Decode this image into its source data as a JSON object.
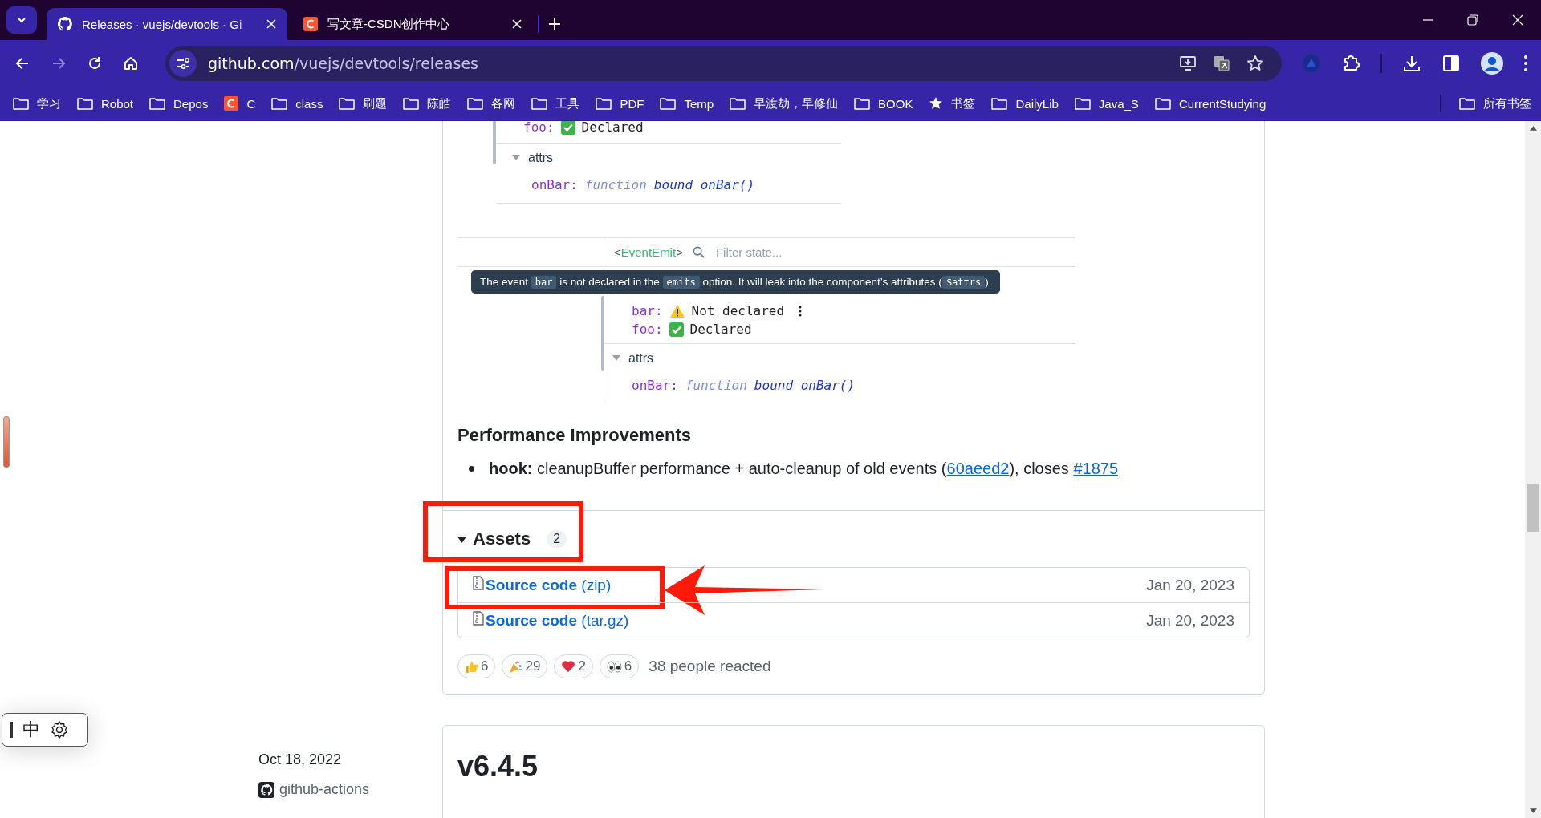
{
  "browser": {
    "tabs": [
      {
        "title": "Releases · vuejs/devtools · Gi",
        "kind": "github",
        "selected": true
      },
      {
        "title": "写文章-CSDN创作中心",
        "kind": "csdn",
        "selected": false
      }
    ],
    "url": {
      "host": "github.com",
      "path": "/vuejs/devtools/releases"
    },
    "bookmarks": [
      {
        "label": "学习",
        "kind": "folder"
      },
      {
        "label": "Robot",
        "kind": "folder"
      },
      {
        "label": "Depos",
        "kind": "folder"
      },
      {
        "label": "C",
        "kind": "csdn"
      },
      {
        "label": "class",
        "kind": "folder"
      },
      {
        "label": "刷题",
        "kind": "folder"
      },
      {
        "label": "陈皓",
        "kind": "folder"
      },
      {
        "label": "各网",
        "kind": "folder"
      },
      {
        "label": "工具",
        "kind": "folder"
      },
      {
        "label": "PDF",
        "kind": "folder"
      },
      {
        "label": "Temp",
        "kind": "folder"
      },
      {
        "label": "早渡劫，早修仙",
        "kind": "folder"
      },
      {
        "label": "BOOK",
        "kind": "folder"
      },
      {
        "label": "书签",
        "kind": "star"
      },
      {
        "label": "DailyLib",
        "kind": "folder"
      },
      {
        "label": "Java_S",
        "kind": "folder"
      },
      {
        "label": "CurrentStudying",
        "kind": "folder"
      }
    ],
    "all_bookmarks": "所有书签"
  },
  "ime": {
    "label": "中"
  },
  "release": {
    "screenshot_top": {
      "emits": [
        {
          "key": "foo:",
          "status": "Declared",
          "kind": "ok",
          "has_menu": false
        }
      ],
      "attrs_label": "attrs",
      "attrs": [
        {
          "key": "onBar:",
          "type": "function",
          "value": "bound onBar()"
        }
      ]
    },
    "screenshot": {
      "component": {
        "open": "<",
        "name": "EventEmit",
        "close": ">"
      },
      "filter_placeholder": "Filter state...",
      "tooltip": [
        {
          "kind": "text",
          "text": "The event "
        },
        {
          "kind": "code",
          "text": "bar"
        },
        {
          "kind": "text",
          "text": " is not declared in the "
        },
        {
          "kind": "code",
          "text": "emits"
        },
        {
          "kind": "text",
          "text": " option. It will leak into the component’s attributes ("
        },
        {
          "kind": "code",
          "text": "$attrs"
        },
        {
          "kind": "text",
          "text": ")."
        }
      ],
      "emits": [
        {
          "key": "bar:",
          "status": "Not declared",
          "kind": "warn",
          "has_menu": true
        },
        {
          "key": "foo:",
          "status": "Declared",
          "kind": "ok",
          "has_menu": false
        }
      ],
      "attrs_label": "attrs",
      "attrs": [
        {
          "key": "onBar:",
          "type": "function",
          "value": "bound onBar()"
        }
      ]
    },
    "heading": "Performance Improvements",
    "bullets": [
      [
        {
          "kind": "bold",
          "text": "hook:"
        },
        {
          "kind": "text",
          "text": " cleanupBuffer performance + auto-cleanup of old events ("
        },
        {
          "kind": "link",
          "text": "60aeed2"
        },
        {
          "kind": "text",
          "text": "), closes "
        },
        {
          "kind": "link",
          "text": "#1875"
        }
      ]
    ],
    "assets": {
      "title": "Assets",
      "count": "2",
      "expanded": true,
      "items": [
        {
          "name": "Source code",
          "ext": "(zip)",
          "date": "Jan 20, 2023"
        },
        {
          "name": "Source code",
          "ext": "(tar.gz)",
          "date": "Jan 20, 2023"
        }
      ]
    },
    "reactions": [
      {
        "kind": "thumbs-up",
        "count": "6"
      },
      {
        "kind": "party",
        "count": "29"
      },
      {
        "kind": "heart",
        "count": "2"
      },
      {
        "kind": "eyes",
        "count": "6"
      }
    ],
    "reactions_summary": "38 people reacted",
    "annotations": [
      {
        "kind": "assets-frame"
      },
      {
        "kind": "asset-frame"
      },
      {
        "kind": "asset-arrow"
      }
    ]
  },
  "next_release": {
    "date": "Oct 18, 2022",
    "author": "github-actions",
    "version": "v6.4.5"
  }
}
